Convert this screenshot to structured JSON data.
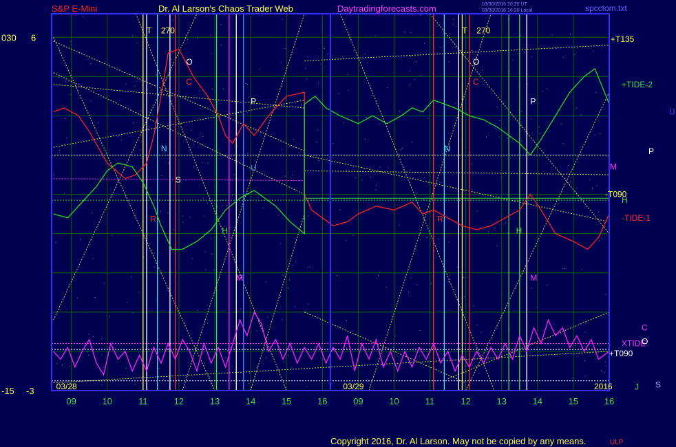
{
  "header": {
    "left": "S&P E-Mini",
    "center": "Dr. Al Larson's Chaos Trader Web",
    "site": "Daytradingforecasts.com",
    "stamp1": "03/30/2016 20:20 UT",
    "stamp2": "03/30/2016 16:20 Local",
    "right": "spcctom.txt"
  },
  "footer": {
    "copyright": "Copyright 2016, Dr. Al Larson. May not be copied by any means."
  },
  "colors": {
    "background": "#000050",
    "frame": "#3030ff",
    "grid": "#006600",
    "price": "#ff2020",
    "tide2": "#20dd20",
    "tide1": "#ff2020",
    "xtide": "#ff20ff",
    "yellow": "#ffff40",
    "white": "#ffffff",
    "cyan": "#40e0ff",
    "magenta": "#ff30ff"
  },
  "chart_data": {
    "type": "line",
    "left_axis_labels": [
      {
        "text": "030",
        "y": 6
      },
      {
        "text": "6",
        "y": 6
      },
      {
        "text": "-15",
        "y": -3
      },
      {
        "text": "-3",
        "y": -3
      }
    ],
    "ylim": [
      -3,
      6.6
    ],
    "x_ticks": [
      "09",
      "10",
      "11",
      "12",
      "13",
      "14",
      "15",
      "16",
      "09",
      "10",
      "11",
      "12",
      "13",
      "14",
      "15",
      "16"
    ],
    "date_labels": [
      {
        "text": "03/28",
        "x": 0.5
      },
      {
        "text": "03/29",
        "x": 8.5
      },
      {
        "text": "2016",
        "x": 15.5
      }
    ],
    "series": [
      {
        "name": "",
        "role": "price",
        "points": [
          [
            0,
            4.1
          ],
          [
            0.3,
            4.2
          ],
          [
            0.7,
            4.0
          ],
          [
            1.0,
            3.6
          ],
          [
            1.5,
            2.8
          ],
          [
            2.0,
            2.4
          ],
          [
            2.3,
            2.5
          ],
          [
            2.6,
            2.8
          ],
          [
            2.8,
            3.5
          ],
          [
            3.0,
            4.5
          ],
          [
            3.2,
            5.6
          ],
          [
            3.5,
            5.7
          ],
          [
            3.9,
            5.0
          ],
          [
            4.3,
            4.5
          ],
          [
            4.6,
            4.0
          ],
          [
            4.8,
            3.5
          ],
          [
            5.0,
            3.3
          ],
          [
            5.3,
            3.8
          ],
          [
            5.6,
            3.5
          ],
          [
            6.0,
            4.0
          ],
          [
            6.5,
            4.5
          ],
          [
            7.0,
            4.6
          ],
          [
            7.0,
            2.0
          ],
          [
            7.2,
            1.6
          ],
          [
            7.5,
            1.4
          ],
          [
            7.8,
            1.2
          ],
          [
            8.2,
            1.3
          ],
          [
            8.5,
            1.5
          ],
          [
            9.0,
            1.7
          ],
          [
            9.5,
            1.6
          ],
          [
            10.0,
            1.8
          ],
          [
            10.3,
            1.5
          ],
          [
            10.6,
            1.6
          ],
          [
            11.0,
            1.4
          ],
          [
            11.4,
            1.2
          ],
          [
            11.8,
            1.1
          ],
          [
            12.2,
            1.2
          ],
          [
            12.6,
            1.4
          ],
          [
            13.0,
            1.6
          ],
          [
            13.3,
            2.0
          ],
          [
            13.6,
            1.6
          ],
          [
            14.0,
            1.0
          ],
          [
            14.5,
            0.8
          ],
          [
            14.9,
            0.6
          ],
          [
            15.2,
            0.9
          ],
          [
            15.5,
            1.5
          ]
        ]
      },
      {
        "name": "+TIDE-2",
        "role": "tide2",
        "points": [
          [
            0,
            1.5
          ],
          [
            0.4,
            1.4
          ],
          [
            0.8,
            1.8
          ],
          [
            1.2,
            2.2
          ],
          [
            1.5,
            2.6
          ],
          [
            1.8,
            2.8
          ],
          [
            2.2,
            2.7
          ],
          [
            2.5,
            2.3
          ],
          [
            2.8,
            1.7
          ],
          [
            3.0,
            1.2
          ],
          [
            3.3,
            0.6
          ],
          [
            3.6,
            0.6
          ],
          [
            4.0,
            0.8
          ],
          [
            4.4,
            1.1
          ],
          [
            4.8,
            1.6
          ],
          [
            5.2,
            1.9
          ],
          [
            5.6,
            2.1
          ],
          [
            5.9,
            1.9
          ],
          [
            6.2,
            1.7
          ],
          [
            6.6,
            1.3
          ],
          [
            7.0,
            1.0
          ],
          [
            7.0,
            4.3
          ],
          [
            7.3,
            4.5
          ],
          [
            7.6,
            4.2
          ],
          [
            8.0,
            4.0
          ],
          [
            8.5,
            3.8
          ],
          [
            8.9,
            4.0
          ],
          [
            9.3,
            3.8
          ],
          [
            9.7,
            4.0
          ],
          [
            10.0,
            4.2
          ],
          [
            10.3,
            4.1
          ],
          [
            10.6,
            4.4
          ],
          [
            10.9,
            4.3
          ],
          [
            11.2,
            4.2
          ],
          [
            11.6,
            4.0
          ],
          [
            12.0,
            3.9
          ],
          [
            12.4,
            3.7
          ],
          [
            12.7,
            3.5
          ],
          [
            13.0,
            3.3
          ],
          [
            13.3,
            3.0
          ],
          [
            13.6,
            3.4
          ],
          [
            14.0,
            4.0
          ],
          [
            14.4,
            4.6
          ],
          [
            14.8,
            5.0
          ],
          [
            15.1,
            5.2
          ],
          [
            15.5,
            4.3
          ]
        ]
      },
      {
        "name": "XTIDE",
        "role": "xtide",
        "points": [
          [
            0,
            -2.0
          ],
          [
            0.2,
            -2.2
          ],
          [
            0.4,
            -1.9
          ],
          [
            0.6,
            -2.4
          ],
          [
            0.8,
            -2.0
          ],
          [
            1.0,
            -1.7
          ],
          [
            1.2,
            -2.3
          ],
          [
            1.4,
            -2.6
          ],
          [
            1.6,
            -1.8
          ],
          [
            1.8,
            -2.2
          ],
          [
            2.0,
            -2.0
          ],
          [
            2.2,
            -2.5
          ],
          [
            2.4,
            -2.1
          ],
          [
            2.6,
            -2.5
          ],
          [
            2.8,
            -1.9
          ],
          [
            3.0,
            -2.3
          ],
          [
            3.2,
            -1.8
          ],
          [
            3.4,
            -2.2
          ],
          [
            3.6,
            -1.7
          ],
          [
            3.8,
            -2.0
          ],
          [
            4.0,
            -2.5
          ],
          [
            4.2,
            -1.8
          ],
          [
            4.4,
            -2.3
          ],
          [
            4.6,
            -1.9
          ],
          [
            4.8,
            -2.4
          ],
          [
            5.0,
            -1.8
          ],
          [
            5.2,
            -1.2
          ],
          [
            5.4,
            -1.6
          ],
          [
            5.6,
            -1.0
          ],
          [
            5.8,
            -1.3
          ],
          [
            6.0,
            -2.0
          ],
          [
            6.2,
            -1.7
          ],
          [
            6.4,
            -2.2
          ],
          [
            6.6,
            -1.8
          ],
          [
            6.8,
            -2.3
          ],
          [
            7.0,
            -1.9
          ],
          [
            7.2,
            -2.2
          ],
          [
            7.4,
            -1.8
          ],
          [
            7.6,
            -2.3
          ],
          [
            7.8,
            -1.9
          ],
          [
            8.0,
            -2.2
          ],
          [
            8.2,
            -1.6
          ],
          [
            8.4,
            -2.5
          ],
          [
            8.6,
            -1.8
          ],
          [
            8.8,
            -2.2
          ],
          [
            9.0,
            -1.7
          ],
          [
            9.2,
            -2.4
          ],
          [
            9.4,
            -2.0
          ],
          [
            9.6,
            -2.5
          ],
          [
            9.8,
            -2.0
          ],
          [
            10.0,
            -2.4
          ],
          [
            10.2,
            -1.9
          ],
          [
            10.4,
            -2.2
          ],
          [
            10.6,
            -1.8
          ],
          [
            10.8,
            -2.3
          ],
          [
            11.0,
            -2.0
          ],
          [
            11.2,
            -2.5
          ],
          [
            11.4,
            -2.1
          ],
          [
            11.6,
            -2.4
          ],
          [
            11.8,
            -2.0
          ],
          [
            12.0,
            -2.3
          ],
          [
            12.2,
            -1.9
          ],
          [
            12.4,
            -2.2
          ],
          [
            12.6,
            -1.8
          ],
          [
            12.8,
            -2.2
          ],
          [
            13.0,
            -1.6
          ],
          [
            13.2,
            -2.0
          ],
          [
            13.4,
            -1.4
          ],
          [
            13.6,
            -1.8
          ],
          [
            13.8,
            -1.2
          ],
          [
            14.0,
            -1.6
          ],
          [
            14.2,
            -1.4
          ],
          [
            14.4,
            -1.9
          ],
          [
            14.6,
            -1.6
          ],
          [
            14.8,
            -2.0
          ],
          [
            15.0,
            -1.7
          ],
          [
            15.2,
            -2.2
          ],
          [
            15.5,
            -2.0
          ]
        ]
      }
    ],
    "hlines": [
      {
        "y": 3.0,
        "color": "#ffffff",
        "dash": true
      },
      {
        "y": 2.4,
        "color": "#ff30ff",
        "dash": true,
        "x0": 0,
        "x1": 7.0,
        "y1": 2.35
      },
      {
        "y": 1.85,
        "color": "#40e040",
        "dash": true
      },
      {
        "y": -1.8,
        "color": "#ff30ff",
        "dash": true
      },
      {
        "y": -1.95,
        "color": "#ffffff",
        "dash": true
      },
      {
        "y": -2.75,
        "color": "#ffffff",
        "dash": true
      },
      {
        "y": 1.9,
        "color": "#40e040",
        "dash": false,
        "x0": 7.0,
        "x1": 15.5
      }
    ],
    "diagonals": [
      [
        0,
        5.9,
        7.0,
        3.1
      ],
      [
        0,
        5.1,
        7.0,
        2.0
      ],
      [
        0,
        4.8,
        7.0,
        4.2
      ],
      [
        0,
        3.2,
        7.0,
        4.4
      ],
      [
        0,
        -2.8,
        15.5,
        -2.0
      ],
      [
        0,
        6.0,
        4.5,
        -3
      ],
      [
        0,
        -1.2,
        4.0,
        6.6
      ],
      [
        2.3,
        6.6,
        6.5,
        -3
      ],
      [
        3.6,
        -3,
        7.0,
        6.6
      ],
      [
        5.5,
        -3,
        7.0,
        1.5
      ],
      [
        7.0,
        2.6,
        15.5,
        2.5
      ],
      [
        7.0,
        3.0,
        15.5,
        1.3
      ],
      [
        7.0,
        5.4,
        15.5,
        5.8
      ],
      [
        8.0,
        6.6,
        12.3,
        -3
      ],
      [
        8.8,
        -3,
        12.2,
        6.6
      ],
      [
        10.5,
        6.6,
        15.5,
        1.0
      ],
      [
        11.5,
        -3,
        15.5,
        4.6
      ],
      [
        11.0,
        -2.7,
        15.5,
        -1.0
      ],
      [
        7.0,
        -1.0,
        11.5,
        -2.8
      ]
    ],
    "vlines": [
      {
        "x": 2.5,
        "color": "#ffff40"
      },
      {
        "x": 2.6,
        "color": "#ffffff"
      },
      {
        "x": 2.9,
        "color": "#40e0ff"
      },
      {
        "x": 3.25,
        "color": "#ffffff"
      },
      {
        "x": 3.4,
        "color": "#ff3030"
      },
      {
        "x": 4.55,
        "color": "#40e040"
      },
      {
        "x": 4.9,
        "color": "#ff30ff"
      },
      {
        "x": 5.1,
        "color": "#ffffff"
      },
      {
        "x": 5.3,
        "color": "#4080ff"
      },
      {
        "x": 10.6,
        "color": "#ff3030"
      },
      {
        "x": 10.9,
        "color": "#40e0ff"
      },
      {
        "x": 11.3,
        "color": "#ffffff"
      },
      {
        "x": 11.4,
        "color": "#ffff40"
      },
      {
        "x": 11.6,
        "color": "#ff3030"
      },
      {
        "x": 12.7,
        "color": "#40e040"
      },
      {
        "x": 13.0,
        "color": "#40e040"
      },
      {
        "x": 13.2,
        "color": "#ffffff"
      }
    ],
    "markers": [
      {
        "text": "T",
        "x": 2.6,
        "y": 6.1,
        "color": "#ffff40"
      },
      {
        "text": "270",
        "x": 3.0,
        "y": 6.1,
        "color": "#ffff40"
      },
      {
        "text": "T",
        "x": 11.4,
        "y": 6.1,
        "color": "#ffff40"
      },
      {
        "text": "270",
        "x": 11.8,
        "y": 6.1,
        "color": "#ffff40"
      },
      {
        "text": "O",
        "x": 3.7,
        "y": 5.3,
        "color": "#ffffff"
      },
      {
        "text": "C",
        "x": 3.7,
        "y": 4.8,
        "color": "#ff3030"
      },
      {
        "text": "P",
        "x": 5.5,
        "y": 4.3,
        "color": "#ffffff"
      },
      {
        "text": "N",
        "x": 3.0,
        "y": 3.1,
        "color": "#40e0ff"
      },
      {
        "text": "S",
        "x": 3.4,
        "y": 2.3,
        "color": "#ffffff"
      },
      {
        "text": "R",
        "x": 2.7,
        "y": 1.3,
        "color": "#ff3030"
      },
      {
        "text": "H",
        "x": 4.7,
        "y": 1.0,
        "color": "#40e040"
      },
      {
        "text": "M",
        "x": 5.1,
        "y": -0.2,
        "color": "#ff30ff"
      },
      {
        "text": "U",
        "x": 5.5,
        "y": 2.6,
        "color": "#4080ff"
      },
      {
        "text": "O",
        "x": 11.7,
        "y": 5.3,
        "color": "#ffffff"
      },
      {
        "text": "C",
        "x": 11.7,
        "y": 4.8,
        "color": "#ff3030"
      },
      {
        "text": "P",
        "x": 13.3,
        "y": 4.3,
        "color": "#ffffff"
      },
      {
        "text": "N",
        "x": 10.9,
        "y": 3.1,
        "color": "#40e0ff"
      },
      {
        "text": "R",
        "x": 10.7,
        "y": 1.3,
        "color": "#ff3030"
      },
      {
        "text": "H",
        "x": 12.9,
        "y": 1.0,
        "color": "#40e040"
      },
      {
        "text": "M",
        "x": 13.3,
        "y": -0.2,
        "color": "#ff30ff"
      }
    ],
    "right_labels": [
      {
        "text": "+T135",
        "y": 5.95,
        "color": "#ffff40"
      },
      {
        "text": "+TIDE-2",
        "y": 4.8,
        "color": "#40e040"
      },
      {
        "text": "U",
        "y": 4.1,
        "color": "#4040ff"
      },
      {
        "text": "P",
        "y": 3.1,
        "color": "#ffffff"
      },
      {
        "text": "M",
        "y": 2.7,
        "color": "#ff30ff"
      },
      {
        "text": "-T090",
        "y": 2.0,
        "color": "#ffff40"
      },
      {
        "text": "H",
        "y": 1.85,
        "color": "#40e040"
      },
      {
        "text": "-TIDE-1",
        "y": 1.4,
        "color": "#ff3030"
      },
      {
        "text": "C",
        "y": -1.4,
        "color": "#ff30ff"
      },
      {
        "text": "XTIDE",
        "y": -1.8,
        "color": "#ff30ff"
      },
      {
        "text": "O",
        "y": -1.75,
        "color": "#ffffff"
      },
      {
        "text": "+T090",
        "y": -2.05,
        "color": "#ffffff"
      },
      {
        "text": "S",
        "y": -2.85,
        "color": "#aaaaff"
      },
      {
        "text": "J",
        "y": -2.9,
        "color": "#40e040"
      }
    ]
  }
}
